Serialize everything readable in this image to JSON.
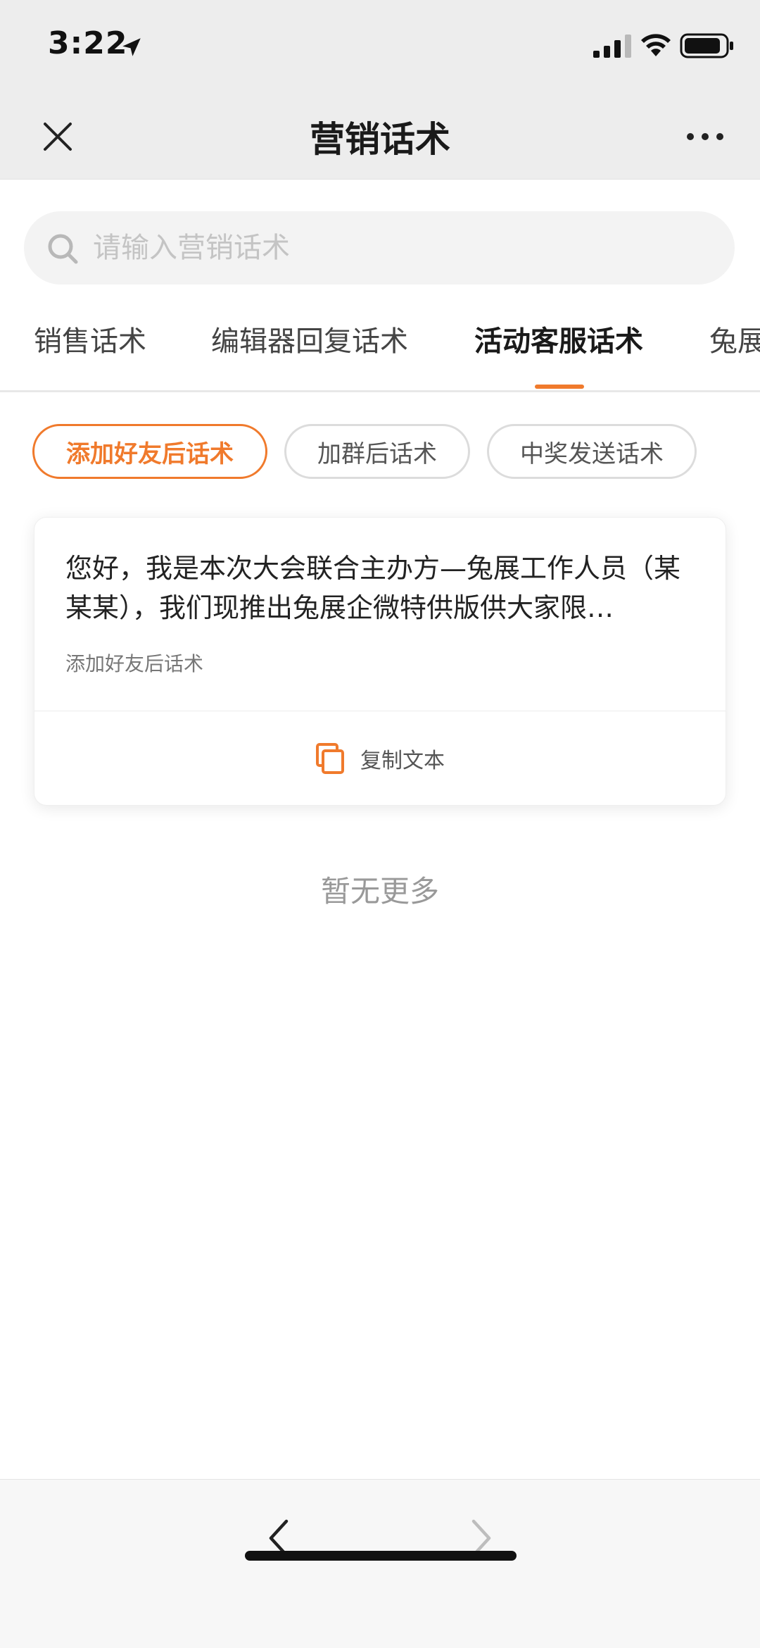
{
  "status_bar": {
    "time": "3:22"
  },
  "nav": {
    "title": "营销话术"
  },
  "search": {
    "placeholder": "请输入营销话术",
    "value": ""
  },
  "tabs": [
    {
      "label": "销售话术",
      "active": false
    },
    {
      "label": "编辑器回复话术",
      "active": false
    },
    {
      "label": "活动客服话术",
      "active": true
    },
    {
      "label": "兔展",
      "active": false
    }
  ],
  "chips": [
    {
      "label": "添加好友后话术",
      "active": true
    },
    {
      "label": "加群后话术",
      "active": false
    },
    {
      "label": "中奖发送话术",
      "active": false
    }
  ],
  "card": {
    "text": "您好，我是本次大会联合主办方—兔展工作人员（某某某），我们现推出兔展企微特供版供大家限…",
    "tag": "添加好友后话术",
    "copy_label": "复制文本"
  },
  "list_end": "暂无更多",
  "colors": {
    "accent": "#f07a2c",
    "nav_bg": "#ededed",
    "bottom_bg": "#f7f7f7"
  },
  "icons": {
    "close": "close-icon",
    "more": "more-dots-icon",
    "search": "search-icon",
    "copy": "copy-icon",
    "back": "chevron-left-icon",
    "forward": "chevron-right-icon"
  }
}
